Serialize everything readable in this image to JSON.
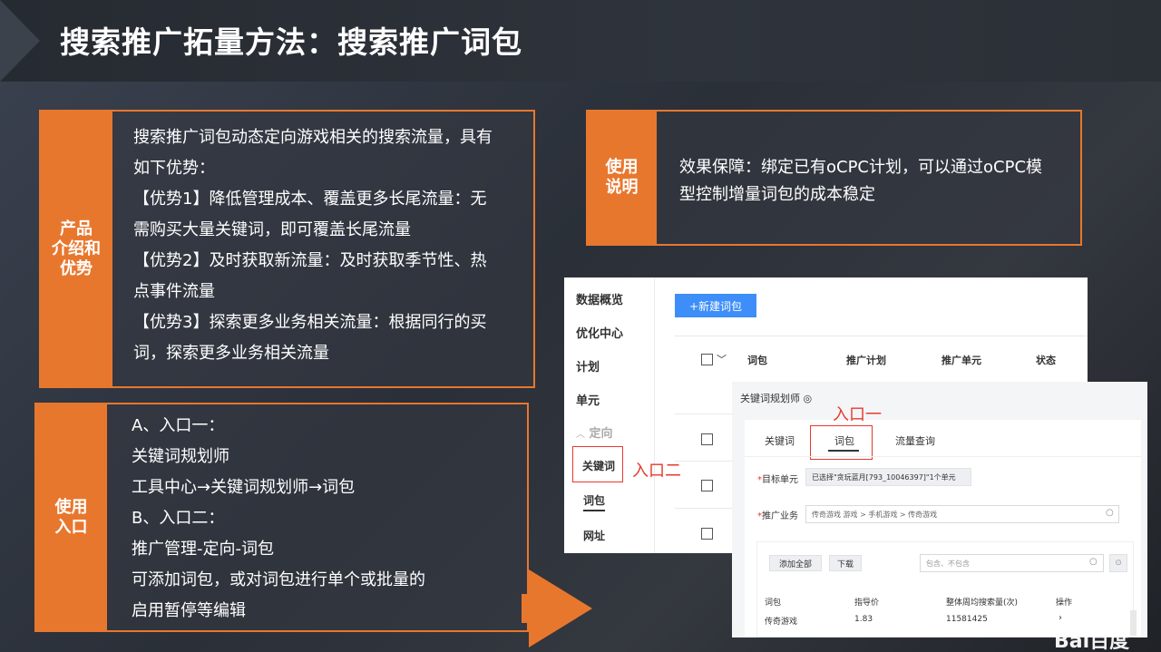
{
  "header": {
    "title": "搜索推广拓量方法：搜索推广词包"
  },
  "product_panel": {
    "tab_label": [
      "产品",
      "介绍和",
      "优势"
    ],
    "lines": [
      "搜索推广词包动态定向游戏相关的搜索流量，具有",
      "如下优势：",
      "【优势1】降低管理成本、覆盖更多长尾流量：无",
      "需购买大量关键词，即可覆盖长尾流量",
      "【优势2】及时获取新流量：及时获取季节性、热",
      "点事件流量",
      "【优势3】探索更多业务相关流量：根据同行的买",
      "词，探索更多业务相关流量"
    ]
  },
  "entry_panel": {
    "tab_label": [
      "使用",
      "入口"
    ],
    "lines": [
      "A、入口一：",
      "关键词规划师",
      "工具中心→关键词规划师→词包",
      "B、入口二：",
      "推广管理-定向-词包",
      "可添加词包，或对词包进行单个或批量的",
      "启用暂停等编辑"
    ]
  },
  "usage_panel": {
    "tab_label": [
      "使用",
      "说明"
    ],
    "lines": [
      "效果保障：绑定已有oCPC计划，可以通过oCPC模",
      "型控制增量词包的成本稳定"
    ]
  },
  "screenshot1": {
    "nav": [
      "数据概览",
      "优化中心",
      "计划",
      "单元",
      "定向",
      "关键词",
      "词包",
      "网址"
    ],
    "new_button": "+新建词包",
    "columns": [
      "词包",
      "推广计划",
      "推广单元",
      "状态"
    ],
    "entry_label": "入口二"
  },
  "screenshot2": {
    "title": "关键词规划师",
    "entry_label": "入口一",
    "tabs": [
      "关键词",
      "词包",
      "流量查询"
    ],
    "target_unit_label": "目标单元",
    "target_unit_value": "已选择\"贪玩蓝月[793_10046397]\"1个单元",
    "business_label": "推广业务",
    "business_value": "传奇游戏  游戏 > 手机游戏 > 传奇游戏",
    "add_all": "添加全部",
    "download": "下载",
    "filter_placeholder": "包含、不包含",
    "table_headers": [
      "词包",
      "指导价",
      "整体周均搜索量(次)",
      "操作"
    ],
    "rows": [
      {
        "name": "传奇游戏",
        "price": "1.83",
        "volume": "11581425",
        "op": "›"
      }
    ]
  },
  "logo": "Bai百度",
  "colors": {
    "accent": "#e8772e",
    "red": "#e8392c",
    "blue": "#3d8ef8"
  }
}
